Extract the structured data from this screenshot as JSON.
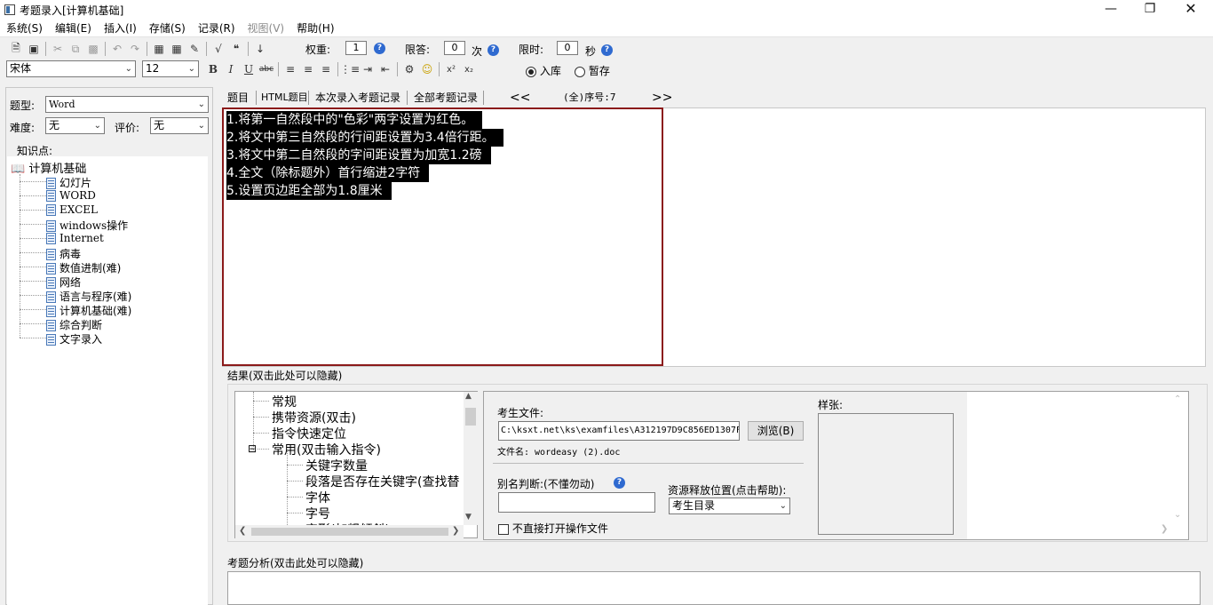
{
  "window": {
    "title": "考题录入[计算机基础]"
  },
  "menu": [
    "系统(S)",
    "编辑(E)",
    "插入(I)",
    "存储(S)",
    "记录(R)",
    "视图(V)",
    "帮助(H)"
  ],
  "toolbar1": {
    "weight_label": "权重:",
    "weight_value": "1",
    "limit_label": "限答:",
    "limit_value": "0",
    "limit_unit": "次",
    "time_label": "限时:",
    "time_value": "0",
    "time_unit": "秒"
  },
  "toolbar2": {
    "font_family": "宋体",
    "font_size": "12",
    "bold": "B",
    "italic": "I",
    "underline": "U",
    "strike": "abc",
    "superscript": "x²",
    "subscript": "x₂",
    "radio_store": "入库",
    "radio_draft": "暂存"
  },
  "left": {
    "type_label": "题型:",
    "type_value": "Word",
    "difficulty_label": "难度:",
    "difficulty_value": "无",
    "rating_label": "评价:",
    "rating_value": "无",
    "kp_label": "知识点:",
    "tree_root": "计算机基础",
    "tree_items": [
      "幻灯片",
      "WORD",
      "EXCEL",
      "windows操作",
      "Internet",
      "病毒",
      "数值进制(难)",
      "网络",
      "语言与程序(难)",
      "计算机基础(难)",
      "综合判断",
      "文字录入"
    ]
  },
  "tabs": [
    "题目",
    "HTML题目",
    "本次录入考题记录",
    "全部考题记录"
  ],
  "nav": {
    "prev": "<<",
    "status": "(全)序号:7",
    "next": ">>"
  },
  "question_lines": [
    "1.将第一自然段中的\"色彩\"两字设置为红色。",
    "2.将文中第三自然段的行间距设置为3.4倍行距。",
    "3.将文中第二自然段的字间距设置为加宽1.2磅",
    "4.全文（除标题外）首行缩进2字符",
    "5.设置页边距全部为1.8厘米"
  ],
  "result": {
    "label": "结果(双击此处可以隐藏)",
    "cmd_tree": [
      {
        "text": "常规",
        "level": 0
      },
      {
        "text": "携带资源(双击)",
        "level": 0
      },
      {
        "text": "指令快速定位",
        "level": 0
      },
      {
        "text": "常用(双击输入指令)",
        "level": 0,
        "expander": "⊟"
      },
      {
        "text": "关键字数量",
        "level": 1
      },
      {
        "text": "段落是否存在关键字(查找替",
        "level": 1
      },
      {
        "text": "字体",
        "level": 1
      },
      {
        "text": "字号",
        "level": 1
      },
      {
        "text": "字形(加粗倾斜)",
        "level": 1
      }
    ],
    "file_label": "考生文件:",
    "file_path": "C:\\ksxt.net\\ks\\examfiles\\A312197D9C856ED1307F",
    "browse_button": "浏览(B)",
    "filename": "文件名: wordeasy (2).doc",
    "alias_label": "别名判断:(不懂勿动)",
    "alias_value": "",
    "resource_label": "资源释放位置(点击帮助):",
    "resource_value": "考生目录",
    "no_open_label": "不直接打开操作文件",
    "sample_label": "样张:"
  },
  "analysis": {
    "label": "考题分析(双击此处可以隐藏)"
  }
}
